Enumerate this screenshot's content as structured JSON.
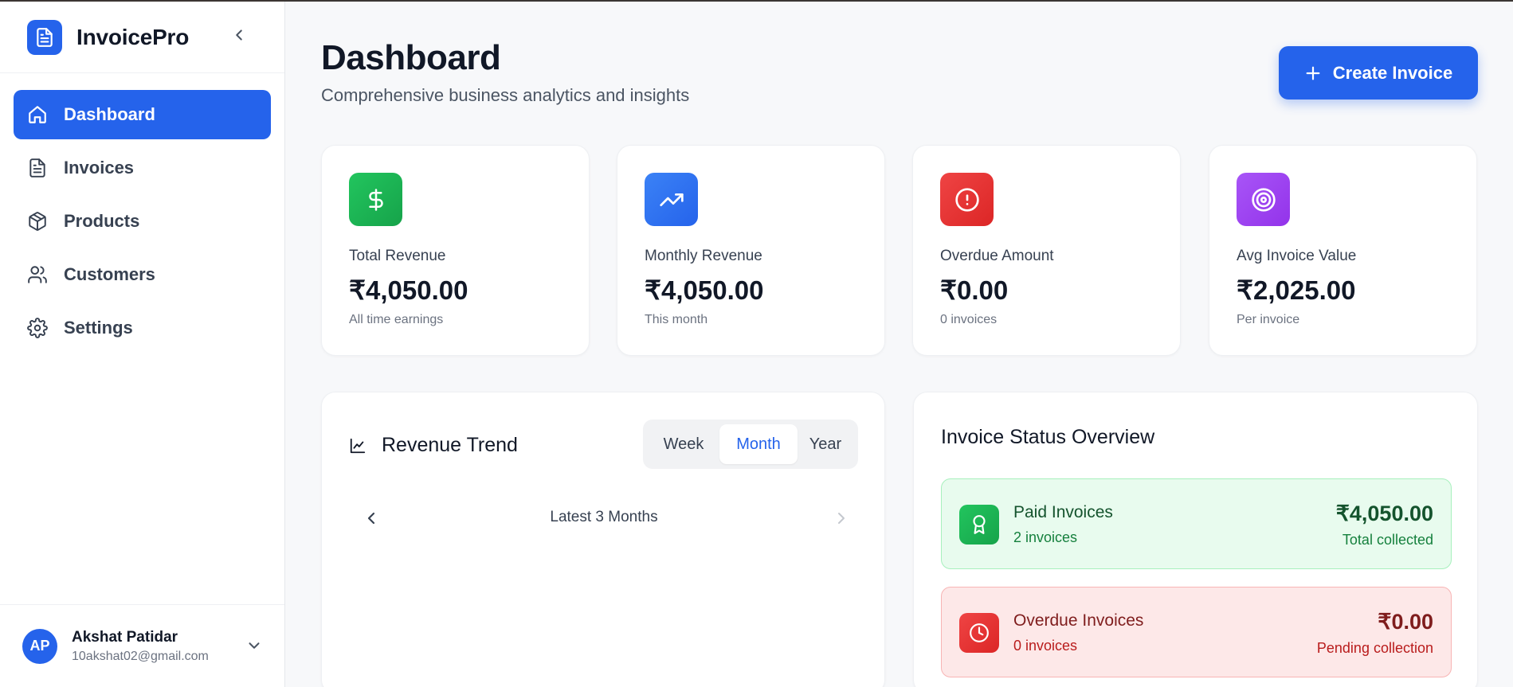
{
  "app": {
    "name": "InvoicePro"
  },
  "sidebar": {
    "items": [
      {
        "label": "Dashboard",
        "icon": "home-icon",
        "active": true
      },
      {
        "label": "Invoices",
        "icon": "document-icon"
      },
      {
        "label": "Products",
        "icon": "package-icon"
      },
      {
        "label": "Customers",
        "icon": "users-icon"
      },
      {
        "label": "Settings",
        "icon": "gear-icon"
      }
    ]
  },
  "user": {
    "initials": "AP",
    "name": "Akshat Patidar",
    "email": "10akshat02@gmail.com"
  },
  "header": {
    "title": "Dashboard",
    "subtitle": "Comprehensive business analytics and insights",
    "create_label": "Create Invoice"
  },
  "stats": [
    {
      "label": "Total Revenue",
      "value": "₹4,050.00",
      "sub": "All time earnings",
      "icon": "dollar-icon",
      "color": "#22c55e"
    },
    {
      "label": "Monthly Revenue",
      "value": "₹4,050.00",
      "sub": "This month",
      "icon": "trending-up-icon",
      "color": "#3b82f6"
    },
    {
      "label": "Overdue Amount",
      "value": "₹0.00",
      "sub": "0 invoices",
      "icon": "alert-circle-icon",
      "color": "#ef4444"
    },
    {
      "label": "Avg Invoice Value",
      "value": "₹2,025.00",
      "sub": "Per invoice",
      "icon": "target-icon",
      "color": "#a855f7"
    }
  ],
  "revenue_trend": {
    "title": "Revenue Trend",
    "tabs": [
      "Week",
      "Month",
      "Year"
    ],
    "active_tab": "Month",
    "period_label": "Latest 3 Months"
  },
  "status_overview": {
    "title": "Invoice Status Overview",
    "paid": {
      "title": "Paid Invoices",
      "count": "2 invoices",
      "amount": "₹4,050.00",
      "note": "Total collected"
    },
    "overdue": {
      "title": "Overdue Invoices",
      "count": "0 invoices",
      "amount": "₹0.00",
      "note": "Pending collection"
    }
  },
  "colors": {
    "primary": "#2563eb",
    "success": "#22c55e",
    "danger": "#ef4444"
  }
}
